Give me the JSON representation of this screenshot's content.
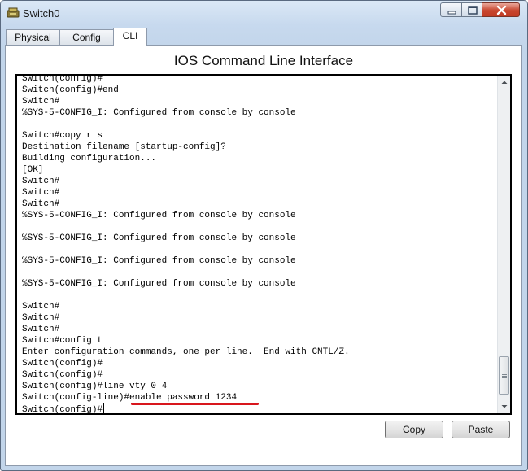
{
  "window": {
    "title": "Switch0"
  },
  "tabs": [
    {
      "label": "Physical",
      "active": false
    },
    {
      "label": "Config",
      "active": false
    },
    {
      "label": "CLI",
      "active": true
    }
  ],
  "panel": {
    "heading": "IOS Command Line Interface"
  },
  "terminal": {
    "lines": [
      "Switch(config)#",
      "Switch(config)#end",
      "Switch#",
      "%SYS-5-CONFIG_I: Configured from console by console",
      "",
      "Switch#copy r s",
      "Destination filename [startup-config]?",
      "Building configuration...",
      "[OK]",
      "Switch#",
      "Switch#",
      "Switch#",
      "%SYS-5-CONFIG_I: Configured from console by console",
      "",
      "%SYS-5-CONFIG_I: Configured from console by console",
      "",
      "%SYS-5-CONFIG_I: Configured from console by console",
      "",
      "%SYS-5-CONFIG_I: Configured from console by console",
      "",
      "Switch#",
      "Switch#",
      "Switch#",
      "Switch#config t",
      "Enter configuration commands, one per line.  End with CNTL/Z.",
      "Switch(config)#",
      "Switch(config)#",
      "Switch(config)#line vty 0 4",
      "Switch(config-line)#enable password 1234",
      "Switch(config)#"
    ],
    "highlight_color": "#d8161d"
  },
  "buttons": {
    "copy": "Copy",
    "paste": "Paste"
  },
  "icons": {
    "app": "switch-icon",
    "minimize": "minimize-icon",
    "maximize": "maximize-icon",
    "close": "close-icon",
    "scroll_up": "arrow-up-icon",
    "scroll_down": "arrow-down-icon"
  }
}
